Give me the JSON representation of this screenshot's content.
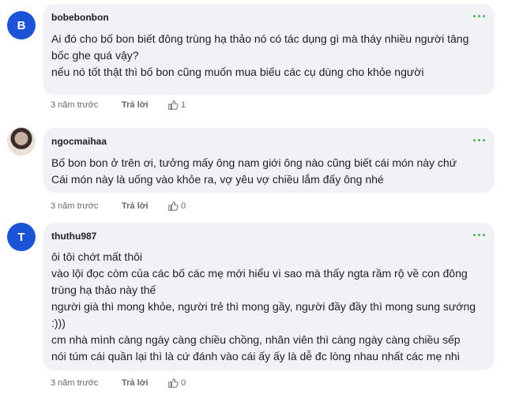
{
  "comments": [
    {
      "avatar_letter": "B",
      "author": "bobebonbon",
      "lines": [
        "Ai đó cho bố bon biết đông trùng hạ thảo nó có tác dụng gì mà tháy nhiều người tâng",
        "bốc ghe quá vậy?",
        "nếu nó tốt thật thì bố bon cũng muốn mua biếu các cụ dùng cho khỏe người"
      ],
      "time": "3 năm trước",
      "reply": "Trả lời",
      "likes": "1"
    },
    {
      "avatar_letter": "",
      "author": "ngocmaihaa",
      "lines": [
        "Bố bon bon ở trên ơi, tưởng mấy ông nam giới ông nào cũng biết cái món này chứ",
        "Cái món này là uống vào khỏe ra, vợ yêu vợ chiều lắm đấy ông nhé"
      ],
      "time": "3 năm trước",
      "reply": "Trả lời",
      "likes": "0"
    },
    {
      "avatar_letter": "T",
      "author": "thuthu987",
      "lines": [
        "ôi tôi chớt mất thôi",
        "vào lội đọc còm của các bố các mẹ mới hiểu vì sao mà thấy ngta rầm rộ về con đông",
        "trùng hạ thảo này thế",
        "người già thì mong khỏe, người trẻ thì mong gầy, người đầy đầy thì mong sung sướng",
        ":)))",
        "cm nhà mình càng ngày càng chiều chồng, nhân viên thì càng ngày càng chiều sếp",
        "nói túm cái quần lại thì là cứ đánh vào cái ấy ấy là dễ đc lòng nhau nhất các mẹ nhi"
      ],
      "time": "3 năm trước",
      "reply": "Trả lời",
      "likes": "0"
    }
  ],
  "colors": {
    "accent": "#1a53d6",
    "more_dots": "#4caf50",
    "bubble": "#f0f2f5"
  },
  "icons": {
    "more": "more-dots-icon",
    "like": "thumbs-up-icon"
  }
}
